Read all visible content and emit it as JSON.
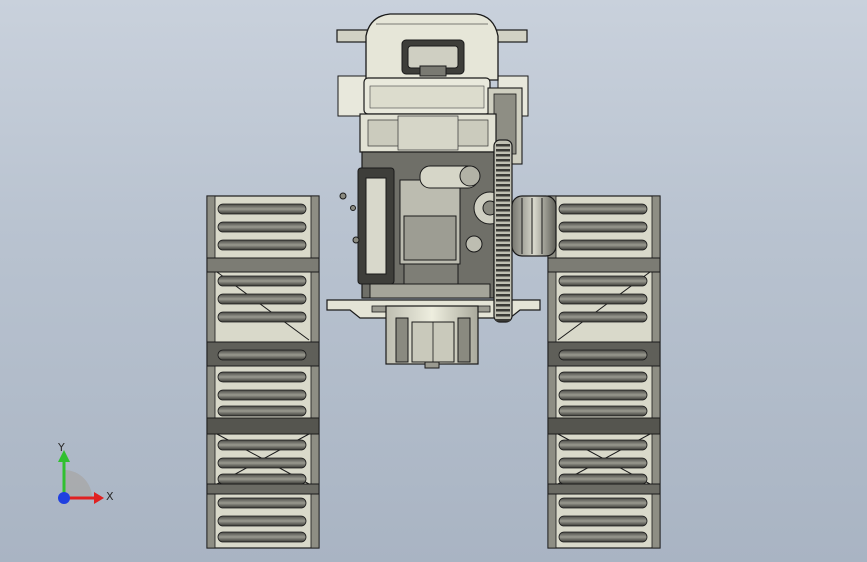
{
  "viewport": {
    "background_top": "#c9d1dc",
    "background_bottom": "#a9b4c3"
  },
  "model": {
    "icon": "tracked-tractor-top-view",
    "body_color": "#dfdfd0",
    "shadow_color": "#6b6b66",
    "line_color": "#1a1a1a"
  },
  "triad": {
    "x_label": "X",
    "y_label": "Y",
    "x_color": "#e02020",
    "y_color": "#30c030",
    "z_color": "#2040e0"
  }
}
